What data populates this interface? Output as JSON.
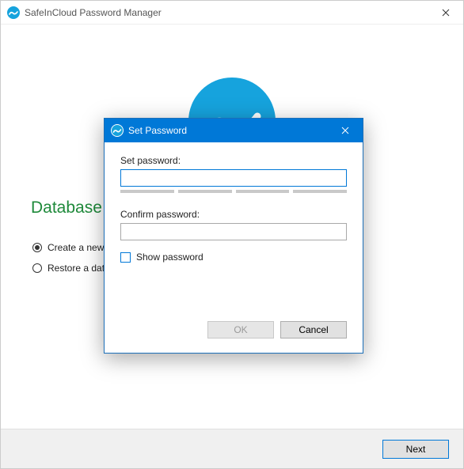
{
  "window": {
    "title": "SafeInCloud Password Manager"
  },
  "main": {
    "heading": "Database Setup",
    "radios": {
      "create": "Create a new database",
      "restore": "Restore a database from a cloud"
    },
    "next": "Next"
  },
  "dialog": {
    "title": "Set Password",
    "set_label": "Set password:",
    "confirm_label": "Confirm password:",
    "show_label": "Show password",
    "ok": "OK",
    "cancel": "Cancel",
    "set_value": "",
    "confirm_value": ""
  },
  "colors": {
    "accent": "#0078d7",
    "heading": "#1f8a3b"
  }
}
